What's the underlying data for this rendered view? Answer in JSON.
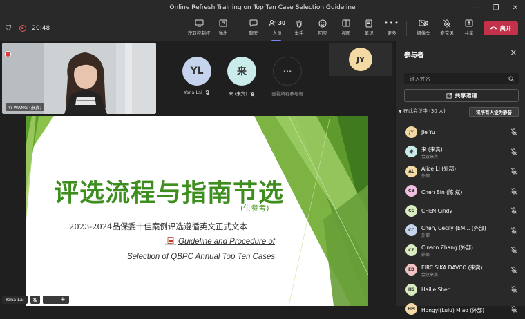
{
  "window": {
    "title": "Online Refresh Training on Top Ten Case Selection Guideline",
    "minimize": "—",
    "restore": "❐",
    "close": "✕"
  },
  "toolbar": {
    "shield": "⛉",
    "timer": "20:48",
    "buttons": [
      {
        "label": "获取控制权",
        "icon": "share-screen-icon"
      },
      {
        "label": "弹出",
        "icon": "popout-icon"
      },
      {
        "label": "聊天",
        "icon": "chat-icon"
      },
      {
        "label": "人员",
        "icon": "people-icon",
        "count": "30"
      },
      {
        "label": "举手",
        "icon": "raise-hand-icon"
      },
      {
        "label": "回应",
        "icon": "react-icon"
      },
      {
        "label": "视图",
        "icon": "view-icon"
      },
      {
        "label": "笔记",
        "icon": "notes-icon"
      },
      {
        "label": "更多",
        "icon": "more-icon"
      },
      {
        "label": "摄像头",
        "icon": "camera-off-icon"
      },
      {
        "label": "麦克风",
        "icon": "mic-off-icon"
      },
      {
        "label": "共享",
        "icon": "share-icon"
      }
    ],
    "leave_label": "离开"
  },
  "stage": {
    "video_name": "Yi WANG (来宾)",
    "avatars": [
      {
        "initials": "YL",
        "name": "Yana Lai",
        "color": "#c5d3ec"
      },
      {
        "initials": "来",
        "name": "来 (来宾)",
        "color": "#c9ecea"
      },
      {
        "initials": "···",
        "name": "查看所有参与者",
        "color": "#1f1f1f"
      }
    ],
    "jy_initials": "JY",
    "bottom_name": "Yana Lai",
    "bottom_plus": "+"
  },
  "slide": {
    "title": "评选流程与指南节选",
    "subtitle": "(供参考)",
    "line1": "2023-2024品保委十佳案例评选遵循英文正式文本",
    "line2": "Guideline and Procedure of",
    "line3": "Selection of QBPC Annual Top Ten Cases",
    "file_tag": "Guideline"
  },
  "panel": {
    "title": "参与者",
    "search_placeholder": "键入姓名",
    "invite_label": "共享邀请",
    "section_label": "在此会议中 (30 人)",
    "mute_all": "将所有人设为静音",
    "participants": [
      {
        "initials": "JY",
        "name": "Jie Yu",
        "sub": "",
        "color": "#f3d9a4"
      },
      {
        "initials": "来",
        "name": "来 (来宾)",
        "sub": "会议来宾",
        "color": "#c9ecea"
      },
      {
        "initials": "AL",
        "name": "Alice LI (外部)",
        "sub": "外部",
        "color": "#f3d9a4"
      },
      {
        "initials": "CB",
        "name": "Chen Bin (陈 斌)",
        "sub": "",
        "color": "#f0c0e0"
      },
      {
        "initials": "CC",
        "name": "CHEN Cindy",
        "sub": "",
        "color": "#d8ecbf"
      },
      {
        "initials": "CC",
        "name": "Chen, Cecily (EM... (外部)",
        "sub": "外部",
        "color": "#c5d3ec"
      },
      {
        "initials": "CZ",
        "name": "Cinson Zhang (外部)",
        "sub": "外部",
        "color": "#d8ecbf"
      },
      {
        "initials": "ED",
        "name": "EIRC SIKA DAVCO (来宾)",
        "sub": "会议来宾",
        "color": "#f3c2c2"
      },
      {
        "initials": "HS",
        "name": "Hailie Shen",
        "sub": "",
        "color": "#d8ecbf"
      },
      {
        "initials": "HM",
        "name": "Hongyi(Lulu) Miao (外部)",
        "sub": "",
        "color": "#f3d9a4"
      }
    ]
  }
}
